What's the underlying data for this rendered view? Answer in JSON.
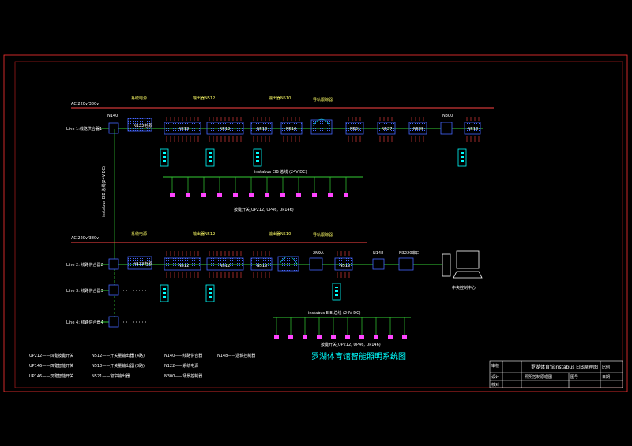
{
  "diagram_title": "罗湖体育馆智能照明系统图",
  "section1": {
    "ac_label": "AC 220v/380v",
    "line_label": "Line 1:线路供合器1",
    "bus_label": "instabus EIB 总线 (24V DC)",
    "bus_vertical_label": "instabus EIB 总线(24V DC)",
    "button_label": "按键开关(UP212, UP46, UP146)",
    "headers": {
      "power": "系统电源",
      "output_n512": "输出器N512",
      "output_n510": "输出器N510",
      "tracker": "导轨跟踪器"
    },
    "modules": {
      "n140": "N140",
      "n512a": "N512",
      "n512b": "N512",
      "n510a": "N510",
      "n510b": "N510",
      "n521": "N521",
      "n527": "N527",
      "n525": "N525",
      "n300": "N300",
      "n510c": "N510"
    }
  },
  "section2": {
    "ac_label": "AC 220v/380v",
    "line_labels": [
      "Line 2: 线路供合器2",
      "Line 3: 线路供合器3",
      "Line 4: 线路供合器4"
    ],
    "bus_label": "instabus EIB 总线 (24V DC)",
    "button_label": "按键开关(UP212, UP46, UP146)",
    "headers": {
      "power": "系统电源",
      "output_n512": "输出器N512",
      "output_n510": "输出器N510",
      "tracker": "导轨跟踪器"
    },
    "modules": {
      "n512a": "N512",
      "n512b": "N512",
      "n510a": "N510",
      "n350": "2N9A",
      "n510b": "N510",
      "n148": "N148",
      "n3220": "N3220串口"
    },
    "control_center": "中央控制中心"
  },
  "legend": [
    [
      "UP212——四键按键开关",
      "N512——开关量输出器 (4路)",
      "N140——线路供合器",
      "N148——逻辑控制器"
    ],
    [
      "UP146——四键智能开关",
      "N510——开关量输出器 (8路)",
      "N122——系统电源",
      ""
    ],
    [
      "UP146——双键智能开关",
      "N521——窗帘输出器",
      "N300——场景控制器",
      ""
    ]
  ],
  "title_block": {
    "main_title": "罗湖体育馆instabus EIB原理图",
    "sub_title": "照明控制原理图",
    "small_labels": [
      "审核",
      "设计",
      "校对",
      "图号",
      "比例",
      "日期"
    ]
  }
}
